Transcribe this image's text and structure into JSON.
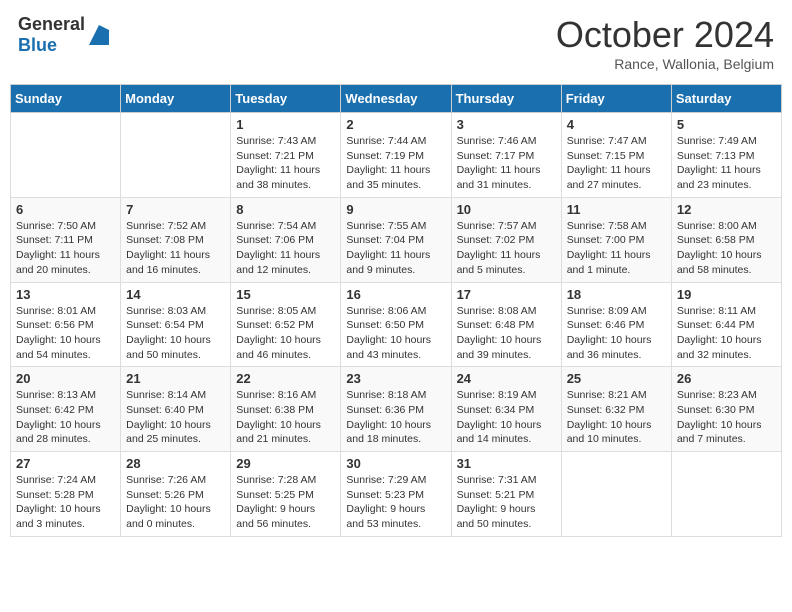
{
  "logo": {
    "general": "General",
    "blue": "Blue"
  },
  "title": "October 2024",
  "location": "Rance, Wallonia, Belgium",
  "days_of_week": [
    "Sunday",
    "Monday",
    "Tuesday",
    "Wednesday",
    "Thursday",
    "Friday",
    "Saturday"
  ],
  "weeks": [
    [
      {
        "day": "",
        "info": ""
      },
      {
        "day": "",
        "info": ""
      },
      {
        "day": "1",
        "info": "Sunrise: 7:43 AM\nSunset: 7:21 PM\nDaylight: 11 hours and 38 minutes."
      },
      {
        "day": "2",
        "info": "Sunrise: 7:44 AM\nSunset: 7:19 PM\nDaylight: 11 hours and 35 minutes."
      },
      {
        "day": "3",
        "info": "Sunrise: 7:46 AM\nSunset: 7:17 PM\nDaylight: 11 hours and 31 minutes."
      },
      {
        "day": "4",
        "info": "Sunrise: 7:47 AM\nSunset: 7:15 PM\nDaylight: 11 hours and 27 minutes."
      },
      {
        "day": "5",
        "info": "Sunrise: 7:49 AM\nSunset: 7:13 PM\nDaylight: 11 hours and 23 minutes."
      }
    ],
    [
      {
        "day": "6",
        "info": "Sunrise: 7:50 AM\nSunset: 7:11 PM\nDaylight: 11 hours and 20 minutes."
      },
      {
        "day": "7",
        "info": "Sunrise: 7:52 AM\nSunset: 7:08 PM\nDaylight: 11 hours and 16 minutes."
      },
      {
        "day": "8",
        "info": "Sunrise: 7:54 AM\nSunset: 7:06 PM\nDaylight: 11 hours and 12 minutes."
      },
      {
        "day": "9",
        "info": "Sunrise: 7:55 AM\nSunset: 7:04 PM\nDaylight: 11 hours and 9 minutes."
      },
      {
        "day": "10",
        "info": "Sunrise: 7:57 AM\nSunset: 7:02 PM\nDaylight: 11 hours and 5 minutes."
      },
      {
        "day": "11",
        "info": "Sunrise: 7:58 AM\nSunset: 7:00 PM\nDaylight: 11 hours and 1 minute."
      },
      {
        "day": "12",
        "info": "Sunrise: 8:00 AM\nSunset: 6:58 PM\nDaylight: 10 hours and 58 minutes."
      }
    ],
    [
      {
        "day": "13",
        "info": "Sunrise: 8:01 AM\nSunset: 6:56 PM\nDaylight: 10 hours and 54 minutes."
      },
      {
        "day": "14",
        "info": "Sunrise: 8:03 AM\nSunset: 6:54 PM\nDaylight: 10 hours and 50 minutes."
      },
      {
        "day": "15",
        "info": "Sunrise: 8:05 AM\nSunset: 6:52 PM\nDaylight: 10 hours and 46 minutes."
      },
      {
        "day": "16",
        "info": "Sunrise: 8:06 AM\nSunset: 6:50 PM\nDaylight: 10 hours and 43 minutes."
      },
      {
        "day": "17",
        "info": "Sunrise: 8:08 AM\nSunset: 6:48 PM\nDaylight: 10 hours and 39 minutes."
      },
      {
        "day": "18",
        "info": "Sunrise: 8:09 AM\nSunset: 6:46 PM\nDaylight: 10 hours and 36 minutes."
      },
      {
        "day": "19",
        "info": "Sunrise: 8:11 AM\nSunset: 6:44 PM\nDaylight: 10 hours and 32 minutes."
      }
    ],
    [
      {
        "day": "20",
        "info": "Sunrise: 8:13 AM\nSunset: 6:42 PM\nDaylight: 10 hours and 28 minutes."
      },
      {
        "day": "21",
        "info": "Sunrise: 8:14 AM\nSunset: 6:40 PM\nDaylight: 10 hours and 25 minutes."
      },
      {
        "day": "22",
        "info": "Sunrise: 8:16 AM\nSunset: 6:38 PM\nDaylight: 10 hours and 21 minutes."
      },
      {
        "day": "23",
        "info": "Sunrise: 8:18 AM\nSunset: 6:36 PM\nDaylight: 10 hours and 18 minutes."
      },
      {
        "day": "24",
        "info": "Sunrise: 8:19 AM\nSunset: 6:34 PM\nDaylight: 10 hours and 14 minutes."
      },
      {
        "day": "25",
        "info": "Sunrise: 8:21 AM\nSunset: 6:32 PM\nDaylight: 10 hours and 10 minutes."
      },
      {
        "day": "26",
        "info": "Sunrise: 8:23 AM\nSunset: 6:30 PM\nDaylight: 10 hours and 7 minutes."
      }
    ],
    [
      {
        "day": "27",
        "info": "Sunrise: 7:24 AM\nSunset: 5:28 PM\nDaylight: 10 hours and 3 minutes."
      },
      {
        "day": "28",
        "info": "Sunrise: 7:26 AM\nSunset: 5:26 PM\nDaylight: 10 hours and 0 minutes."
      },
      {
        "day": "29",
        "info": "Sunrise: 7:28 AM\nSunset: 5:25 PM\nDaylight: 9 hours and 56 minutes."
      },
      {
        "day": "30",
        "info": "Sunrise: 7:29 AM\nSunset: 5:23 PM\nDaylight: 9 hours and 53 minutes."
      },
      {
        "day": "31",
        "info": "Sunrise: 7:31 AM\nSunset: 5:21 PM\nDaylight: 9 hours and 50 minutes."
      },
      {
        "day": "",
        "info": ""
      },
      {
        "day": "",
        "info": ""
      }
    ]
  ]
}
